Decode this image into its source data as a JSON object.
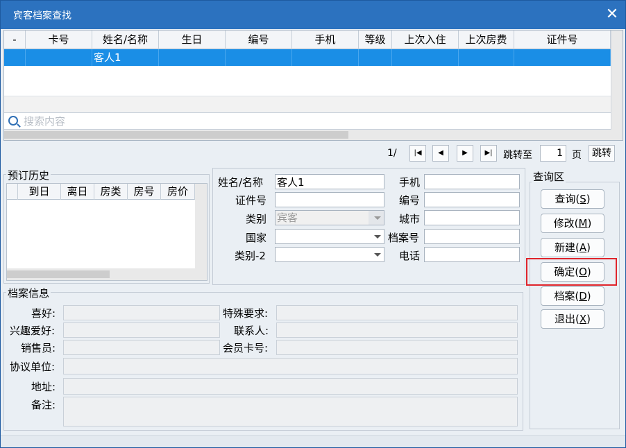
{
  "window": {
    "title": "宾客档案查找",
    "close_glyph": "✕"
  },
  "grid": {
    "columns": [
      "-",
      "卡号",
      "姓名/名称",
      "生日",
      "编号",
      "手机",
      "等级",
      "上次入住",
      "上次房费",
      "证件号"
    ],
    "rows": [
      [
        "",
        "",
        "客人1",
        "",
        "",
        "",
        "",
        "",
        "",
        ""
      ]
    ]
  },
  "search": {
    "placeholder": "搜索内容",
    "value": ""
  },
  "pager": {
    "page_text": "1/",
    "jump_to": "跳转至",
    "page_value": "1",
    "page_unit": "页",
    "jump_button": "跳转"
  },
  "booking_history": {
    "title": "预订历史",
    "columns": [
      "到日",
      "离日",
      "房类",
      "房号",
      "房价"
    ]
  },
  "form": {
    "name_label": "姓名/名称",
    "name_value": "客人1",
    "mobile_label": "手机",
    "mobile_value": "",
    "id_label": "证件号",
    "id_value": "",
    "number_label": "编号",
    "number_value": "",
    "category_label": "类别",
    "category_value": "宾客",
    "city_label": "城市",
    "city_value": "",
    "country_label": "国家",
    "country_value": "",
    "archive_no_label": "档案号",
    "archive_no_value": "",
    "category2_label": "类别-2",
    "category2_value": "",
    "phone_label": "电话",
    "phone_value": ""
  },
  "archive_info": {
    "title": "档案信息",
    "hobby_label": "喜好:",
    "special_label": "特殊要求:",
    "interest_label": "兴趣爱好:",
    "contact_label": "联系人:",
    "sales_label": "销售员:",
    "member_card_label": "会员卡号:",
    "agreement_label": "协议单位:",
    "address_label": "地址:",
    "remark_label": "备注:"
  },
  "query_area": {
    "title": "查询区",
    "buttons": [
      {
        "text": "查询",
        "key": "S"
      },
      {
        "text": "修改",
        "key": "M"
      },
      {
        "text": "新建",
        "key": "A"
      },
      {
        "text": "确定",
        "key": "O"
      },
      {
        "text": "档案",
        "key": "D"
      },
      {
        "text": "退出",
        "key": "X"
      }
    ]
  },
  "colors": {
    "titlebar": "#2c72bf",
    "selection": "#1a8ee6",
    "highlight_box": "#e0242b"
  }
}
